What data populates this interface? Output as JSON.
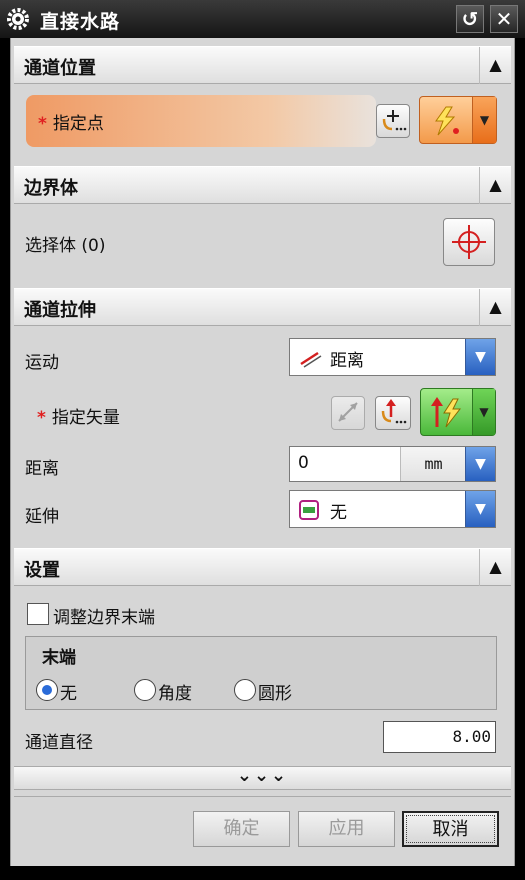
{
  "window": {
    "title": "直接水路",
    "reset_icon": "↺",
    "close_icon": "✕"
  },
  "section_channel_position": {
    "header": "通道位置",
    "specify_point": "指定点",
    "required_mark": "*"
  },
  "section_boundary": {
    "header": "边界体",
    "select_body": "选择体 (0)"
  },
  "section_channel_extrude": {
    "header": "通道拉伸",
    "motion_label": "运动",
    "motion_value": "距离",
    "specify_vector": "指定矢量",
    "required_mark": "*",
    "distance_label": "距离",
    "distance_value": "0",
    "distance_unit": "mm",
    "extend_label": "延伸",
    "extend_value": "无"
  },
  "section_settings": {
    "header": "设置",
    "adjust_boundary_end": "调整边界末端",
    "end_group_title": "末端",
    "end_options": [
      "无",
      "角度",
      "圆形"
    ],
    "end_selected": "无",
    "channel_diameter_label": "通道直径",
    "channel_diameter_value": "8.00"
  },
  "more_chevrons": "⌄⌄⌄",
  "buttons": {
    "ok": "确定",
    "apply": "应用",
    "cancel": "取消"
  },
  "colors": {
    "titlebar": "#1e1e1e",
    "highlight_row": "#ef9a64",
    "dropdown_arrow": "#2860c0",
    "required_star": "#e02020",
    "vector_button": "#49b83a"
  }
}
